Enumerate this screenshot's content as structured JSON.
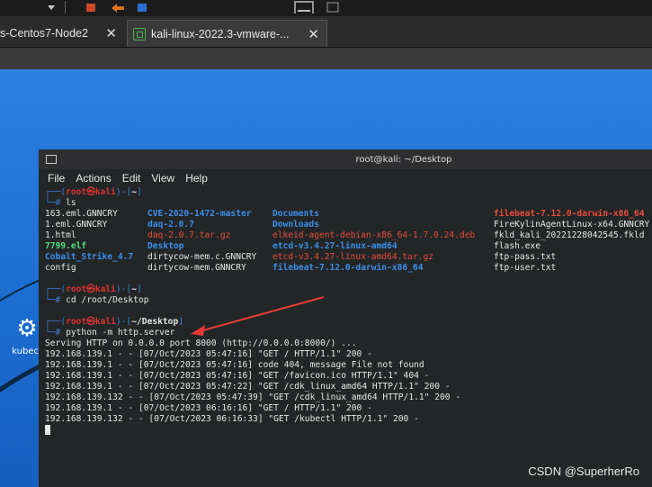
{
  "tabs": [
    {
      "label": "s-Centos7-Node2",
      "close": "✕"
    },
    {
      "label": "kali-linux-2022.3-vmware-...",
      "close": "✕"
    }
  ],
  "desktop_icon": {
    "label": "kubect"
  },
  "terminal": {
    "title": "root@kali: ~/Desktop",
    "menu": [
      "File",
      "Actions",
      "Edit",
      "View",
      "Help"
    ],
    "prompt_open": "┌──(",
    "prompt_user": "root",
    "prompt_at": "㉿",
    "prompt_host": "kali",
    "prompt_sep": ")-[",
    "prompt_close": "]",
    "prompt_hash": "└─#",
    "blocks": [
      {
        "path": "~",
        "cmd": "ls"
      },
      {
        "path": "~",
        "cmd": "cd /root/Desktop"
      },
      {
        "path": "~/Desktop",
        "cmd": "python -m http.server"
      }
    ],
    "ls_rows": [
      [
        "163.eml.GNNCRY",
        "CVE-2020-1472-master",
        "Documents",
        "filebeat-7.12.0-darwin-x86_64"
      ],
      [
        "1.eml.GNNCRY",
        "daq-2.0.7",
        "Downloads",
        "FireKylinAgentLinux-x64.GNNCRY"
      ],
      [
        "1.html",
        "daq-2.0.7.tar.gz",
        "elkeid-agent-debian-x86_64-1.7.0.24.deb",
        "fkld_kali_20221228042545.fkld"
      ],
      [
        "7799.elf",
        "Desktop",
        "etcd-v3.4.27-linux-amd64",
        "flash.exe"
      ],
      [
        "Cobalt_Strike_4.7",
        "dirtycow-mem.c.GNNCRY",
        "etcd-v3.4.27-linux-amd64.tar.gz",
        "ftp-pass.txt"
      ],
      [
        "config",
        "dirtycow-mem.GNNCRY",
        "filebeat-7.12.0-darwin-x86_64",
        "ftp-user.txt"
      ]
    ],
    "ls_colors": [
      [
        "wht",
        "blue",
        "blue",
        "redb"
      ],
      [
        "wht",
        "blue",
        "blue",
        "wht"
      ],
      [
        "wht",
        "red",
        "red",
        "wht"
      ],
      [
        "green",
        "blue",
        "blue",
        "wht"
      ],
      [
        "blue",
        "wht",
        "red",
        "wht"
      ],
      [
        "wht",
        "wht",
        "blue",
        "wht"
      ]
    ],
    "server_lines": [
      "Serving HTTP on 0.0.0.0 port 8000 (http://0.0.0.0:8000/) ...",
      "192.168.139.1 - - [07/Oct/2023 05:47:16] \"GET / HTTP/1.1\" 200 -",
      "192.168.139.1 - - [07/Oct/2023 05:47:16] code 404, message File not found",
      "192.168.139.1 - - [07/Oct/2023 05:47:16] \"GET /favicon.ico HTTP/1.1\" 404 -",
      "192.168.139.1 - - [07/Oct/2023 05:47:22] \"GET /cdk_linux_amd64 HTTP/1.1\" 200 -",
      "192.168.139.132 - - [07/Oct/2023 05:47:39] \"GET /cdk_linux_amd64 HTTP/1.1\" 200 -",
      "192.168.139.1 - - [07/Oct/2023 06:16:16] \"GET / HTTP/1.1\" 200 -",
      "192.168.139.132 - - [07/Oct/2023 06:16:33] \"GET /kubectl HTTP/1.1\" 200 -"
    ]
  },
  "watermark": "CSDN @SuperherRo",
  "colors": {
    "accent_arrow": "#e53935",
    "terminal_bg": "#232627",
    "desktop_bg": "#1f6fd0"
  }
}
